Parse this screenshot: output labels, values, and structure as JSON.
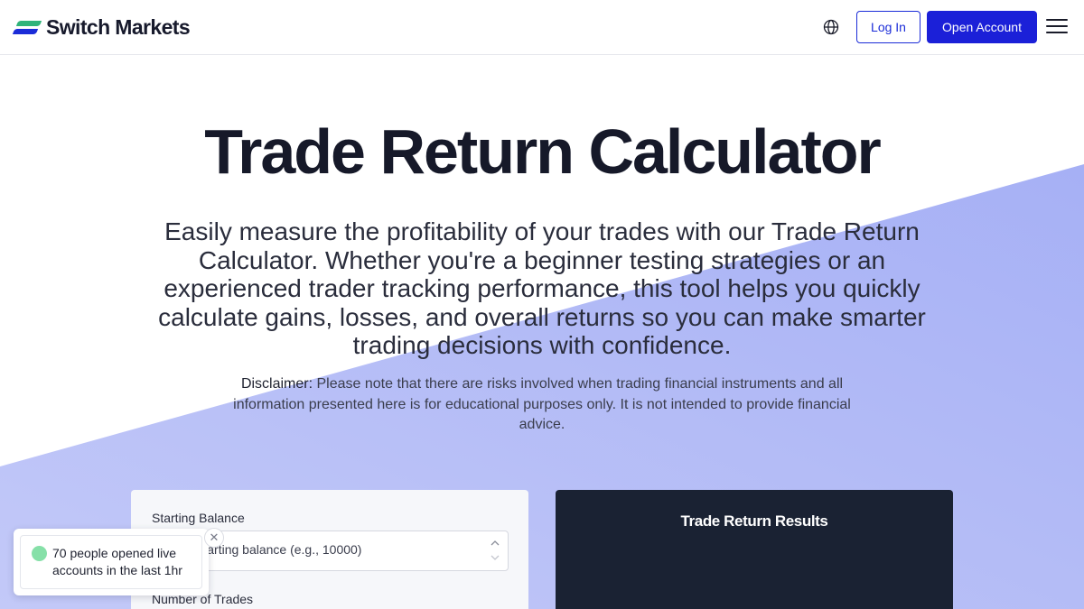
{
  "header": {
    "brand_name": "Switch Markets",
    "login_label": "Log In",
    "open_account_label": "Open Account"
  },
  "hero": {
    "title": "Trade Return Calculator",
    "description": "Easily measure the profitability of your trades with our Trade Return Calculator. Whether you're a beginner testing strategies or an experienced trader tracking performance, this tool helps you quickly calculate gains, losses, and overall returns so you can make smarter trading decisions with confidence.",
    "disclaimer_label": "Disclaimer:",
    "disclaimer_text": " Please note that there are risks involved when trading financial instruments and all information presented here is for educational purposes only. It is not intended to provide financial advice."
  },
  "form": {
    "starting_balance_label": "Starting Balance",
    "starting_balance_placeholder": "Enter starting balance (e.g., 10000)",
    "number_of_trades_label": "Number of Trades"
  },
  "results": {
    "title": "Trade Return Results"
  },
  "toast": {
    "text": "70 people opened live accounts in the last 1hr",
    "close_symbol": "✕"
  },
  "colors": {
    "brand_blue": "#1b20d8",
    "brand_green": "#2fb37a",
    "diagonal_band": "#aab4f5",
    "results_bg": "#1a2233"
  },
  "icons": [
    "globe-icon",
    "menu-icon",
    "close-icon",
    "chevron-up-icon",
    "chevron-down-icon"
  ]
}
